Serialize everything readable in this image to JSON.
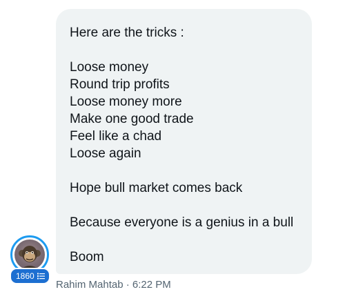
{
  "message": {
    "lines": [
      "Here are the tricks :",
      "",
      "Loose money",
      "Round trip profits",
      "Loose money more",
      "Make one good trade",
      "Feel like a chad",
      "Loose again",
      "",
      "Hope bull market comes back",
      "",
      "Because everyone is a genius in a bull",
      "",
      "Boom"
    ]
  },
  "sender": {
    "name": "Rahim Mahtab",
    "separator": "·",
    "time": "6:22 PM",
    "badge_count": "1860"
  },
  "colors": {
    "bubble_bg": "#eff3f4",
    "text": "#0f1419",
    "meta_text": "#536471",
    "accent": "#1d9bf0",
    "badge_bg": "#1d6fd1"
  },
  "icons": {
    "badge_icon": "ordered-list-icon",
    "avatar": "ape-avatar"
  }
}
